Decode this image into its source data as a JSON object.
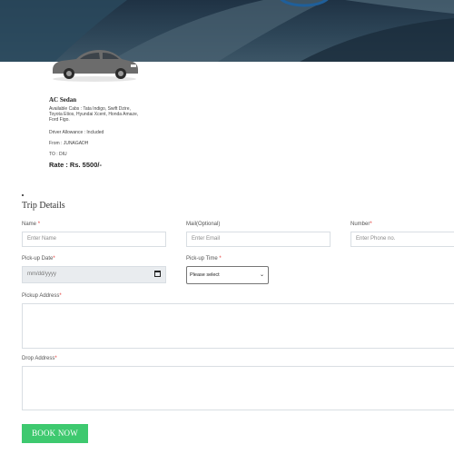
{
  "car": {
    "title": "AC Sedan",
    "available": "Available Cabs : Tata Indigo, Swift Dzire, Toyota Etios, Hyundai Xcent, Honda Amaze, Ford Figo.",
    "driver": "Driver Allowance : Included",
    "from": "From : JUNAGADH",
    "to": "TO : DIU",
    "rate": "Rate : Rs. 5500/-"
  },
  "form": {
    "title": "Trip Details",
    "name_label": "Name",
    "name_placeholder": "Enter Name",
    "mail_label": "Mail(Optional)",
    "mail_placeholder": "Enter Email",
    "number_label": "Number",
    "number_placeholder": "Enter Phone no.",
    "pickup_date_label": "Pick-up Date",
    "date_placeholder": "mm/dd/yyyy",
    "pickup_time_label": "Pick-up Time",
    "time_select_value": "Please select",
    "pickup_address_label": "Pickup Address",
    "drop_address_label": "Drop Address",
    "required_mark": "*",
    "submit_label": "BOOK NOW"
  },
  "colors": {
    "accent_button": "#3ec96f",
    "required": "#e53935",
    "hero_dark": "#1f3244"
  }
}
